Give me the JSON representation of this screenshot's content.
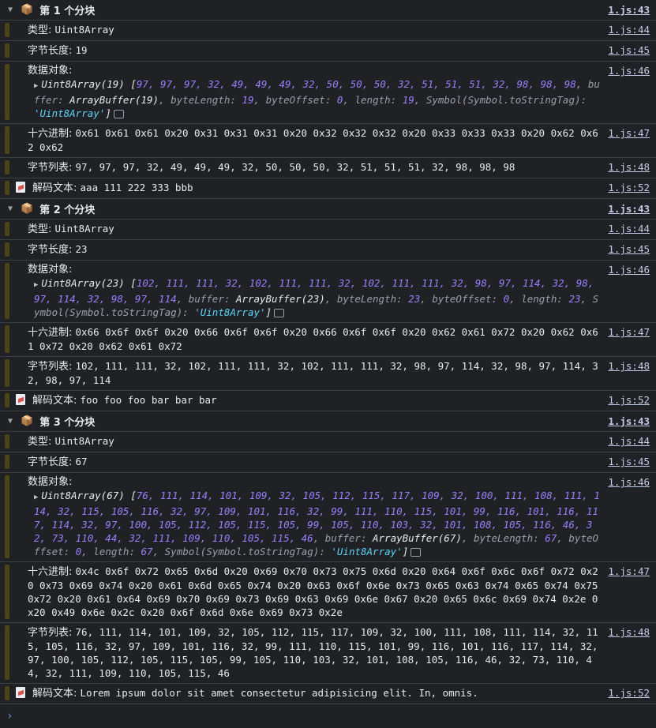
{
  "groups": [
    {
      "title": "第 1 个分块",
      "header_link": "1.js:43",
      "type_label": "类型: ",
      "type_value": "Uint8Array",
      "type_link": "1.js:44",
      "len_label": "字节长度: ",
      "len_value": "19",
      "len_link": "1.js:45",
      "obj_label": "数据对象:",
      "obj_link": "1.js:46",
      "obj_name": "Uint8Array(19)",
      "obj_values": "97, 97, 97, 32, 49, 49, 49, 32, 50, 50, 50, 32, 51, 51, 51, 32, 98, 98, 98",
      "obj_buffer": "ArrayBuffer(19)",
      "obj_bytelen": "19",
      "obj_offset": "0",
      "obj_length": "19",
      "obj_tag": "'Uint8Array'",
      "hex_label": "十六进制: ",
      "hex_value": "0x61 0x61 0x61 0x20 0x31 0x31 0x31 0x20 0x32 0x32 0x32 0x20 0x33 0x33 0x33 0x20 0x62 0x62 0x62",
      "hex_link": "1.js:47",
      "list_label": "字节列表: ",
      "list_value": "97, 97, 97, 32, 49, 49, 49, 32, 50, 50, 50, 32, 51, 51, 51, 32, 98, 98, 98",
      "list_link": "1.js:48",
      "decode_label": "解码文本: ",
      "decode_value": "aaa 111 222 333 bbb",
      "decode_link": "1.js:52"
    },
    {
      "title": "第 2 个分块",
      "header_link": "1.js:43",
      "type_label": "类型: ",
      "type_value": "Uint8Array",
      "type_link": "1.js:44",
      "len_label": "字节长度: ",
      "len_value": "23",
      "len_link": "1.js:45",
      "obj_label": "数据对象:",
      "obj_link": "1.js:46",
      "obj_name": "Uint8Array(23)",
      "obj_values": "102, 111, 111, 32, 102, 111, 111, 32, 102, 111, 111, 32, 98, 97, 114, 32, 98, 97, 114, 32, 98, 97, 114",
      "obj_buffer": "ArrayBuffer(23)",
      "obj_bytelen": "23",
      "obj_offset": "0",
      "obj_length": "23",
      "obj_tag": "'Uint8Array'",
      "hex_label": "十六进制: ",
      "hex_value": "0x66 0x6f 0x6f 0x20 0x66 0x6f 0x6f 0x20 0x66 0x6f 0x6f 0x20 0x62 0x61 0x72 0x20 0x62 0x61 0x72 0x20 0x62 0x61 0x72",
      "hex_link": "1.js:47",
      "list_label": "字节列表: ",
      "list_value": "102, 111, 111, 32, 102, 111, 111, 32, 102, 111, 111, 32, 98, 97, 114, 32, 98, 97, 114, 32, 98, 97, 114",
      "list_link": "1.js:48",
      "decode_label": "解码文本: ",
      "decode_value": "foo foo foo bar bar bar",
      "decode_link": "1.js:52"
    },
    {
      "title": "第 3 个分块",
      "header_link": "1.js:43",
      "type_label": "类型: ",
      "type_value": "Uint8Array",
      "type_link": "1.js:44",
      "len_label": "字节长度: ",
      "len_value": "67",
      "len_link": "1.js:45",
      "obj_label": "数据对象:",
      "obj_link": "1.js:46",
      "obj_name": "Uint8Array(67)",
      "obj_values": "76, 111, 114, 101, 109, 32, 105, 112, 115, 117, 109, 32, 100, 111, 108, 111, 114, 32, 115, 105, 116, 32, 97, 109, 101, 116, 32, 99, 111, 110, 115, 101, 99, 116, 101, 116, 117, 114, 32, 97, 100, 105, 112, 105, 115, 105, 99, 105, 110, 103, 32, 101, 108, 105, 116, 46, 32, 73, 110, 44, 32, 111, 109, 110, 105, 115, 46",
      "obj_buffer": "ArrayBuffer(67)",
      "obj_bytelen": "67",
      "obj_offset": "0",
      "obj_length": "67",
      "obj_tag": "'Uint8Array'",
      "hex_label": "十六进制: ",
      "hex_value": "0x4c 0x6f 0x72 0x65 0x6d 0x20 0x69 0x70 0x73 0x75 0x6d 0x20 0x64 0x6f 0x6c 0x6f 0x72 0x20 0x73 0x69 0x74 0x20 0x61 0x6d 0x65 0x74 0x20 0x63 0x6f 0x6e 0x73 0x65 0x63 0x74 0x65 0x74 0x75 0x72 0x20 0x61 0x64 0x69 0x70 0x69 0x73 0x69 0x63 0x69 0x6e 0x67 0x20 0x65 0x6c 0x69 0x74 0x2e 0x20 0x49 0x6e 0x2c 0x20 0x6f 0x6d 0x6e 0x69 0x73 0x2e",
      "hex_link": "1.js:47",
      "list_label": "字节列表: ",
      "list_value": "76, 111, 114, 101, 109, 32, 105, 112, 115, 117, 109, 32, 100, 111, 108, 111, 114, 32, 115, 105, 116, 32, 97, 109, 101, 116, 32, 99, 111, 110, 115, 101, 99, 116, 101, 116, 117, 114, 32, 97, 100, 105, 112, 105, 115, 105, 99, 105, 110, 103, 32, 101, 108, 105, 116, 46, 32, 73, 110, 44, 32, 111, 109, 110, 105, 115, 46",
      "list_link": "1.js:48",
      "decode_label": "解码文本: ",
      "decode_value": "Lorem ipsum dolor sit amet consectetur adipisicing elit. In, omnis.",
      "decode_link": "1.js:52"
    }
  ],
  "obj_keys": {
    "buffer": "buffer",
    "byteLength": "byteLength",
    "byteOffset": "byteOffset",
    "length": "length",
    "symbol": "Symbol(Symbol.toStringTag)"
  },
  "icons": {
    "group_icon": "package-box-icon",
    "decode_icon": "memo-icon",
    "prompt_icon": "chevron-right-icon"
  },
  "prompt": "›"
}
